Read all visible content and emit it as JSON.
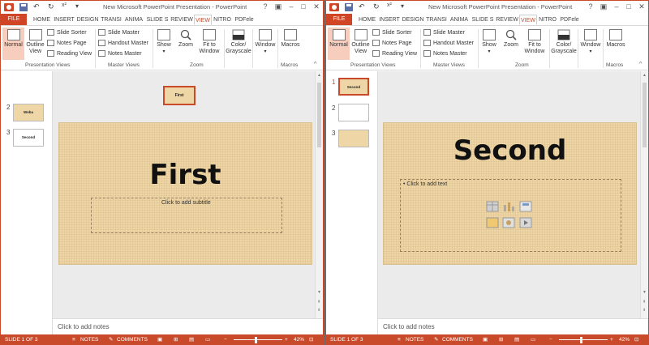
{
  "app": {
    "title": "New Microsoft PowerPoint Presentation - PowerPoint",
    "accent": "#c94a2a"
  },
  "tabs": [
    "FILE",
    "HOME",
    "INSERT",
    "DESIGN",
    "TRANSI",
    "ANIMA",
    "SLIDE S",
    "REVIEW",
    "VIEW",
    "NITRO",
    "PDFele"
  ],
  "ribbon": {
    "normal": "Normal",
    "outline": "Outline View",
    "slide_sorter": "Slide Sorter",
    "notes_page": "Notes Page",
    "reading_view": "Reading View",
    "slide_master": "Slide Master",
    "handout_master": "Handout Master",
    "notes_master": "Notes Master",
    "show": "Show",
    "zoom": "Zoom",
    "fit": "Fit to Window",
    "color": "Color/ Grayscale",
    "window": "Window",
    "macros": "Macros",
    "groups": {
      "presentation_views": "Presentation Views",
      "master_views": "Master Views",
      "zoom": "Zoom",
      "macros": "Macros"
    }
  },
  "left": {
    "thumbs": [
      {
        "num": "2",
        "label": "Weba"
      },
      {
        "num": "3",
        "label": "Second"
      }
    ],
    "dragged_thumb": "First",
    "slide_title": "First",
    "subtitle_placeholder": "Click to add subtitle",
    "notes": "Click to add notes"
  },
  "right": {
    "thumbs": [
      {
        "num": "1",
        "label": "Second"
      },
      {
        "num": "2",
        "label": ""
      },
      {
        "num": "3",
        "label": ""
      }
    ],
    "slide_title": "Second",
    "content_placeholder": "• Click to add text",
    "notes": "Click to add notes"
  },
  "status": {
    "slide": "SLIDE 1 OF 3",
    "notes": "NOTES",
    "comments": "COMMENTS",
    "zoom": "42%"
  }
}
